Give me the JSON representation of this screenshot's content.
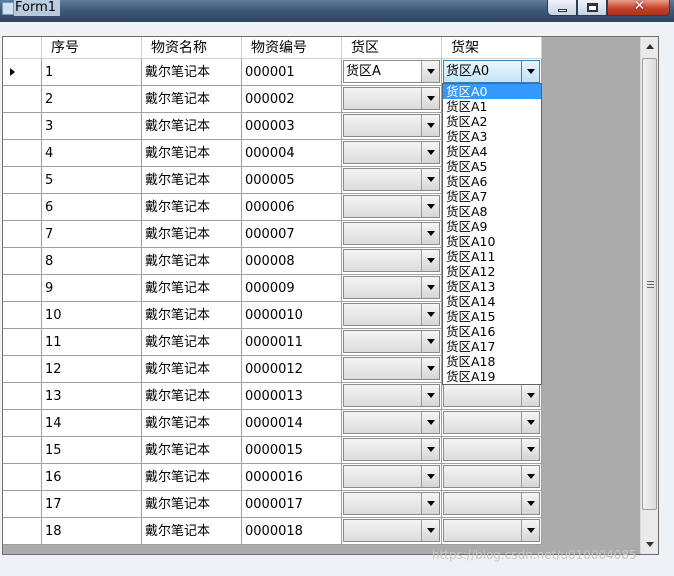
{
  "window": {
    "title": "Form1"
  },
  "grid": {
    "columns": [
      "序号",
      "物资名称",
      "物资编号",
      "货区",
      "货架"
    ],
    "rows": [
      {
        "seq": "1",
        "name": "戴尔笔记本",
        "code": "000001",
        "area": "货区A",
        "shelf": "货区A0"
      },
      {
        "seq": "2",
        "name": "戴尔笔记本",
        "code": "000002",
        "area": "",
        "shelf": ""
      },
      {
        "seq": "3",
        "name": "戴尔笔记本",
        "code": "000003",
        "area": "",
        "shelf": ""
      },
      {
        "seq": "4",
        "name": "戴尔笔记本",
        "code": "000004",
        "area": "",
        "shelf": ""
      },
      {
        "seq": "5",
        "name": "戴尔笔记本",
        "code": "000005",
        "area": "",
        "shelf": ""
      },
      {
        "seq": "6",
        "name": "戴尔笔记本",
        "code": "000006",
        "area": "",
        "shelf": ""
      },
      {
        "seq": "7",
        "name": "戴尔笔记本",
        "code": "000007",
        "area": "",
        "shelf": ""
      },
      {
        "seq": "8",
        "name": "戴尔笔记本",
        "code": "000008",
        "area": "",
        "shelf": ""
      },
      {
        "seq": "9",
        "name": "戴尔笔记本",
        "code": "000009",
        "area": "",
        "shelf": ""
      },
      {
        "seq": "10",
        "name": "戴尔笔记本",
        "code": "0000010",
        "area": "",
        "shelf": ""
      },
      {
        "seq": "11",
        "name": "戴尔笔记本",
        "code": "0000011",
        "area": "",
        "shelf": ""
      },
      {
        "seq": "12",
        "name": "戴尔笔记本",
        "code": "0000012",
        "area": "",
        "shelf": ""
      },
      {
        "seq": "13",
        "name": "戴尔笔记本",
        "code": "0000013",
        "area": "",
        "shelf": ""
      },
      {
        "seq": "14",
        "name": "戴尔笔记本",
        "code": "0000014",
        "area": "",
        "shelf": ""
      },
      {
        "seq": "15",
        "name": "戴尔笔记本",
        "code": "0000015",
        "area": "",
        "shelf": ""
      },
      {
        "seq": "16",
        "name": "戴尔笔记本",
        "code": "0000016",
        "area": "",
        "shelf": ""
      },
      {
        "seq": "17",
        "name": "戴尔笔记本",
        "code": "0000017",
        "area": "",
        "shelf": ""
      },
      {
        "seq": "18",
        "name": "戴尔笔记本",
        "code": "0000018",
        "area": "",
        "shelf": ""
      }
    ],
    "current_row_index": 0
  },
  "dropdown": {
    "open_on_row": 0,
    "selected": "货区A0",
    "options": [
      "货区A0",
      "货区A1",
      "货区A2",
      "货区A3",
      "货区A4",
      "货区A5",
      "货区A6",
      "货区A7",
      "货区A8",
      "货区A9",
      "货区A10",
      "货区A11",
      "货区A12",
      "货区A13",
      "货区A14",
      "货区A15",
      "货区A16",
      "货区A17",
      "货区A18",
      "货区A19"
    ]
  },
  "watermark": "https://blog.csdn.net/u010004085",
  "colors": {
    "selection": "#3399ff",
    "grid_background": "#ababab",
    "title_bar": "#3f5a78"
  }
}
